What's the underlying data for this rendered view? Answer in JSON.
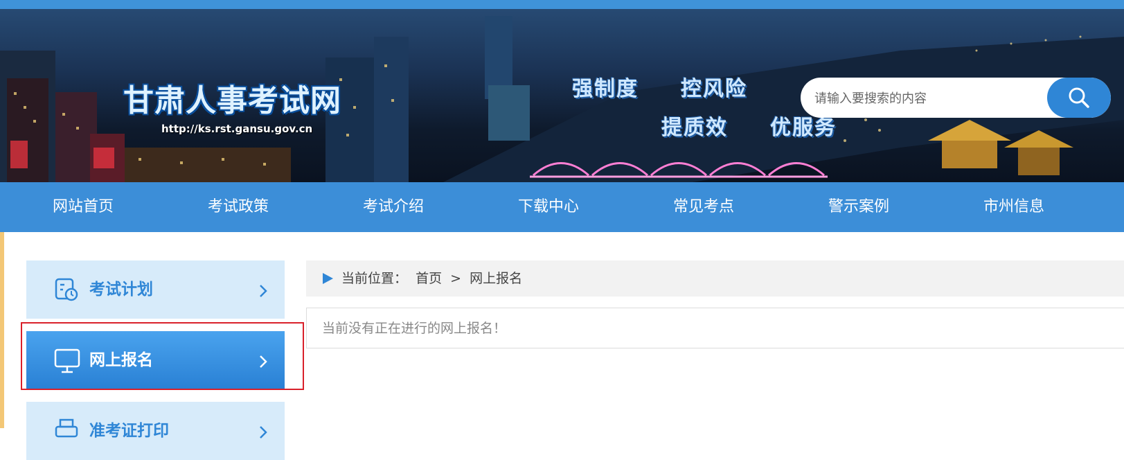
{
  "site": {
    "title": "甘肃人事考试网",
    "url": "http://ks.rst.gansu.gov.cn",
    "slogans": [
      "强制度",
      "控风险",
      "提质效",
      "优服务"
    ]
  },
  "search": {
    "placeholder": "请输入要搜索的内容",
    "button_icon": "search-icon"
  },
  "nav": {
    "items": [
      "网站首页",
      "考试政策",
      "考试介绍",
      "下载中心",
      "常见考点",
      "警示案例",
      "市州信息"
    ]
  },
  "sidebar": {
    "items": [
      {
        "label": "考试计划",
        "icon": "calendar-clock-icon",
        "active": false
      },
      {
        "label": "网上报名",
        "icon": "monitor-icon",
        "active": true
      },
      {
        "label": "准考证打印",
        "icon": "printer-icon",
        "active": false
      }
    ]
  },
  "breadcrumb": {
    "prefix": "当前位置：",
    "home": "首页",
    "separator": ">",
    "current": "网上报名"
  },
  "content": {
    "message": "当前没有正在进行的网上报名！"
  },
  "colors": {
    "nav_bg": "#3c8ed8",
    "accent": "#2f86d6",
    "sidebar_bg": "#d7ebfa",
    "highlight_border": "#d9202a"
  }
}
